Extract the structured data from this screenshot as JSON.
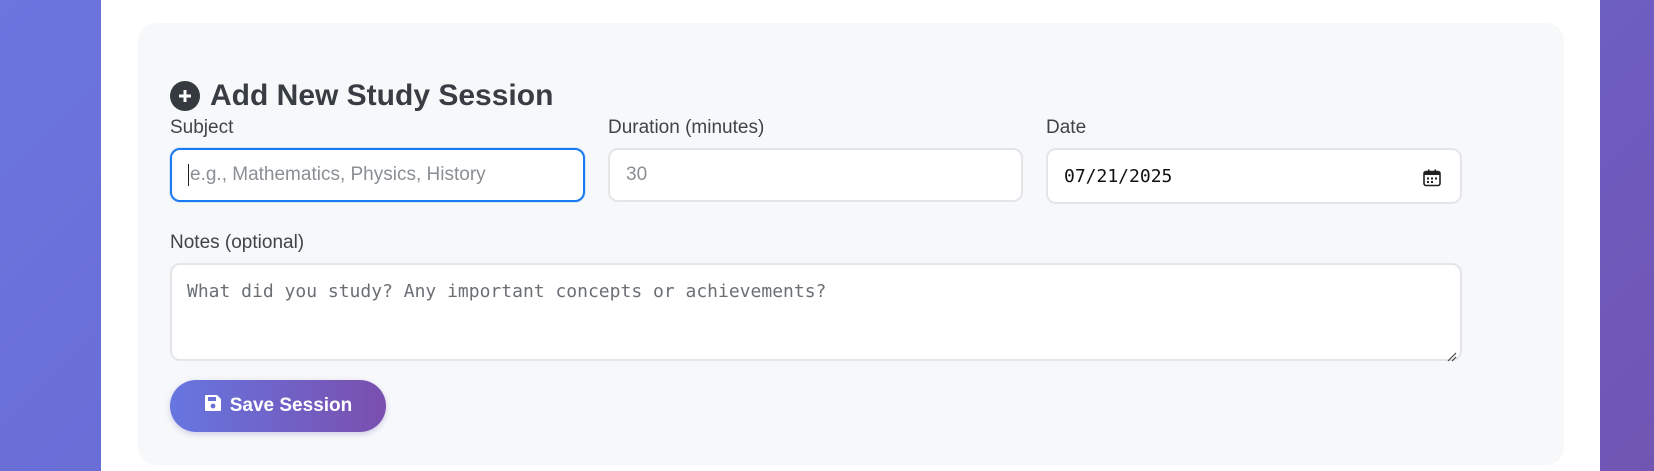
{
  "form": {
    "title": "Add New Study Session",
    "subject": {
      "label": "Subject",
      "placeholder": "e.g., Mathematics, Physics, History",
      "value": ""
    },
    "duration": {
      "label": "Duration (minutes)",
      "placeholder": "30",
      "value": ""
    },
    "date": {
      "label": "Date",
      "value": "07/21/2025"
    },
    "notes": {
      "label": "Notes (optional)",
      "placeholder": "What did you study? Any important concepts or achievements?",
      "value": ""
    },
    "save_label": "Save Session"
  },
  "icons": {
    "title_icon": "plus-circle-icon",
    "date_icon": "calendar-icon",
    "save_icon": "floppy-disk-icon"
  },
  "colors": {
    "accent_focus": "#1a7bf0",
    "button_gradient_start": "#6676e0",
    "button_gradient_end": "#7a4fae",
    "panel_background": "#f7f8fa"
  }
}
